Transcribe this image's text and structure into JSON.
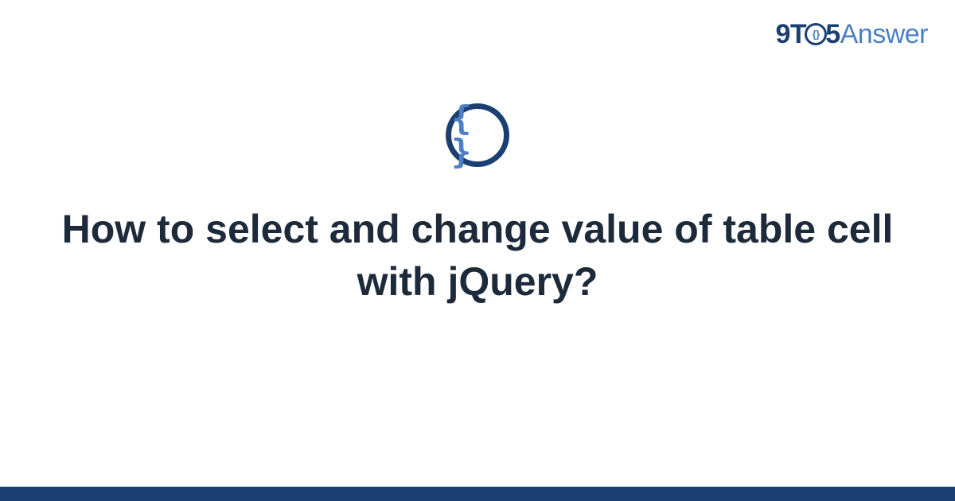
{
  "brand": {
    "prefix": "9T",
    "o_inner": "{}",
    "middle": "5",
    "suffix": "Answer"
  },
  "center_icon": {
    "glyph": "{ }",
    "name": "code-braces-icon"
  },
  "question": {
    "title": "How to select and change value of table cell with jQuery?"
  },
  "colors": {
    "dark_blue": "#1c3f72",
    "light_blue": "#4a7fc5",
    "text": "#1d2a3a"
  }
}
